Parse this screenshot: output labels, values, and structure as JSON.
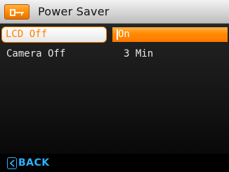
{
  "header": {
    "title": "Power Saver",
    "icon": "power-saver-icon",
    "accent_color": "#ff8a00"
  },
  "menu": {
    "items": [
      {
        "label": "LCD Off",
        "value": "On",
        "selected": true
      },
      {
        "label": "Camera Off",
        "value": "3 Min",
        "selected": false
      }
    ]
  },
  "footer": {
    "back_label": "BACK",
    "back_icon": "back-arrow-icon",
    "accent_color": "#2fb0ff"
  }
}
